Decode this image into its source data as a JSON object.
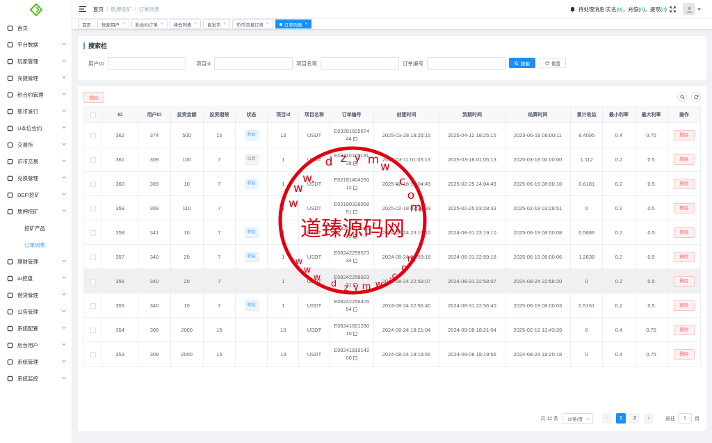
{
  "colors": {
    "primary": "#1890ff",
    "danger": "#f56c6c",
    "success": "#13ce66",
    "stamp": "#e0000f"
  },
  "sidebar": {
    "items": [
      {
        "label": "首页",
        "icon": "dashboard-icon"
      },
      {
        "label": "平台数据",
        "icon": "chart-icon"
      },
      {
        "label": "玩家管理",
        "icon": "user-icon"
      },
      {
        "label": "充提管理",
        "icon": "wallet-icon"
      },
      {
        "label": "秒合约管理",
        "icon": "contract-icon"
      },
      {
        "label": "新币发行",
        "icon": "coin-icon"
      },
      {
        "label": "U本位合约",
        "icon": "grid-icon"
      },
      {
        "label": "交易所",
        "icon": "exchange-icon"
      },
      {
        "label": "币币交易",
        "icon": "list-icon"
      },
      {
        "label": "兑换管理",
        "icon": "swap-icon"
      },
      {
        "label": "DEFI挖矿",
        "icon": "defi-icon"
      },
      {
        "label": "质押挖矿",
        "icon": "bar-chart-icon"
      },
      {
        "label": "挖矿产品",
        "icon": ""
      },
      {
        "label": "订单列表",
        "icon": ""
      },
      {
        "label": "理财管理",
        "icon": "finance-icon"
      },
      {
        "label": "AI挖盘",
        "icon": "ai-icon"
      },
      {
        "label": "借贷管理",
        "icon": "loan-icon"
      },
      {
        "label": "公告管理",
        "icon": "notice-icon"
      },
      {
        "label": "系统配置",
        "icon": "config-icon"
      },
      {
        "label": "后台用户",
        "icon": "admin-icon"
      },
      {
        "label": "系统管理",
        "icon": "gear-icon"
      },
      {
        "label": "系统监控",
        "icon": "monitor-icon"
      }
    ]
  },
  "header": {
    "breadcrumb": [
      "首页",
      "质押挖矿",
      "订单列表"
    ],
    "pending_label": "待处理消息:",
    "realname_label": "实名(",
    "realname_count": "0",
    "recharge_label": "充值(",
    "recharge_count": "0",
    "withdraw_label": "提现(",
    "withdraw_count": "0",
    "close_paren": ")",
    "sep": "，"
  },
  "tags": [
    {
      "label": "首页",
      "closable": false
    },
    {
      "label": "玩家用户",
      "closable": true
    },
    {
      "label": "秒合约订单",
      "closable": true
    },
    {
      "label": "持仓列表",
      "closable": true
    },
    {
      "label": "自发币",
      "closable": true
    },
    {
      "label": "币币交易订单",
      "closable": true
    },
    {
      "label": "订单列表",
      "closable": true,
      "active": true
    }
  ],
  "search": {
    "title": "搜索栏",
    "fields": [
      "用户ID",
      "项目id",
      "项目名称",
      "订单编号"
    ],
    "search_btn": "搜索",
    "reset_btn": "重置"
  },
  "table": {
    "delete_btn": "删除",
    "columns": [
      "",
      "ID",
      "用户ID",
      "投资金额",
      "投资期限",
      "状态",
      "项目id",
      "项目名称",
      "订单编号",
      "创建时间",
      "到期时间",
      "结算时间",
      "累计收益",
      "最小利率",
      "最大利率",
      "操作"
    ],
    "rows": [
      {
        "id": "362",
        "uid": "374",
        "amount": "500",
        "term": "15",
        "status": "收益",
        "status_type": "blue",
        "pid": "13",
        "pname": "USDT",
        "order1": "E03281825674",
        "order2": "44",
        "created": "2025-03-28 18:25:15",
        "expire": "2025-04-12 18:25:15",
        "settle": "2025-06-19 08:00:11",
        "profit": "8.4095",
        "min": "0.4",
        "max": "0.75"
      },
      {
        "id": "361",
        "uid": "309",
        "amount": "100",
        "term": "7",
        "status": "结算",
        "status_type": "gray",
        "pid": "1",
        "pname": "USDT",
        "order1": "E03110105181",
        "order2": "38",
        "created": "2025-03-11 01:05:13",
        "expire": "2025-03-18 01:05:13",
        "settle": "2025-03-18 00:00:00",
        "profit": "1.112",
        "min": "0.2",
        "max": "0.5"
      },
      {
        "id": "360",
        "uid": "309",
        "amount": "10",
        "term": "7",
        "status": "收益",
        "status_type": "blue",
        "pid": "1",
        "pname": "USDT",
        "order1": "E02181404250",
        "order2": "12",
        "created": "2025-02-18 14:04:49",
        "expire": "2025-02-25 14:04:49",
        "settle": "2025-06-19 08:00:10",
        "profit": "0.6181",
        "min": "0.2",
        "max": "0.5"
      },
      {
        "id": "359",
        "uid": "309",
        "amount": "110",
        "term": "7",
        "status": "",
        "status_type": "",
        "pid": "1",
        "pname": "USDT",
        "order1": "E02180328958",
        "order2": "51",
        "created": "2025-02-18 03:28:33",
        "expire": "2025-02-25 03:28:33",
        "settle": "2025-02-18 03:28:51",
        "profit": "0",
        "min": "0.2",
        "max": "0.5"
      },
      {
        "id": "358",
        "uid": "341",
        "amount": "10",
        "term": "7",
        "status": "收益",
        "status_type": "blue",
        "pid": "1",
        "pname": "USDT",
        "order1": "E08242319101",
        "order2": "25",
        "created": "2024-08-24 23:19:10",
        "expire": "2024-08-31 23:19:10",
        "settle": "2025-06-19 08:00:08",
        "profit": "0.5886",
        "min": "0.2",
        "max": "0.5"
      },
      {
        "id": "357",
        "uid": "340",
        "amount": "20",
        "term": "7",
        "status": "收益",
        "status_type": "blue",
        "pid": "1",
        "pname": "USDT",
        "order1": "E08242259573",
        "order2": "34",
        "created": "2024-08-24 22:59:18",
        "expire": "2024-08-31 22:59:18",
        "settle": "2025-06-19 08:00:06",
        "profit": "1.2638",
        "min": "0.2",
        "max": "0.5"
      },
      {
        "id": "356",
        "uid": "340",
        "amount": "20",
        "term": "7",
        "status": "",
        "status_type": "",
        "pid": "1",
        "pname": "USDT",
        "order1": "E08242258923",
        "order2": "31",
        "created": "2024-08-24 22:58:07",
        "expire": "2024-08-31 22:58:07",
        "settle": "2024-08-24 22:58:20",
        "profit": "0",
        "min": "0.2",
        "max": "0.5"
      },
      {
        "id": "355",
        "uid": "340",
        "amount": "10",
        "term": "7",
        "status": "收益",
        "status_type": "blue",
        "pid": "1",
        "pname": "USDT",
        "order1": "E08242256405",
        "order2": "54",
        "created": "2024-08-24 22:56:40",
        "expire": "2024-08-31 22:56:40",
        "settle": "2025-06-19 08:00:03",
        "profit": "0.5161",
        "min": "0.2",
        "max": "0.5"
      },
      {
        "id": "354",
        "uid": "309",
        "amount": "2000",
        "term": "15",
        "status": "",
        "status_type": "",
        "pid": "13",
        "pname": "USDT",
        "order1": "E08241821280",
        "order2": "10",
        "created": "2024-08-24 18:21:04",
        "expire": "2024-09-08 18:21:04",
        "settle": "2025-02-12 13:43:39",
        "profit": "0",
        "min": "0.4",
        "max": "0.75"
      },
      {
        "id": "353",
        "uid": "309",
        "amount": "2000",
        "term": "15",
        "status": "",
        "status_type": "",
        "pid": "13",
        "pname": "USDT",
        "order1": "E08241819142",
        "order2": "00",
        "created": "2024-08-24 18:19:56",
        "expire": "2024-09-08 18:19:56",
        "settle": "2024-08-24 18:20:18",
        "profit": "0",
        "min": "0.4",
        "max": "0.75"
      }
    ],
    "row_delete_label": "删除"
  },
  "pager": {
    "total": "共 12 条",
    "size": "10条/页",
    "pages": [
      "1",
      "2"
    ],
    "current": "1",
    "goto_label": "前往",
    "goto_value": "1",
    "page_suffix": "页"
  },
  "watermark": {
    "center_text": "道臻源码网",
    "top_text": "www.dzymw.com",
    "bottom_text": "www.dzymw.com"
  }
}
